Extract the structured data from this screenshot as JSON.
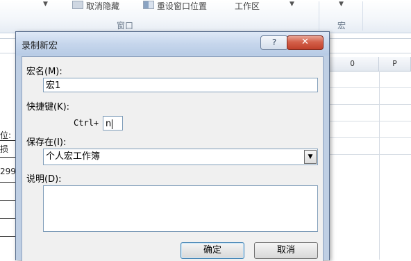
{
  "ribbon": {
    "commands": {
      "hide": "取消隐藏",
      "reset_window": "重设窗口位置",
      "workspace": "工作区"
    },
    "groups": {
      "window": "窗口",
      "macro": "宏"
    }
  },
  "spreadsheet": {
    "columns": [
      "O",
      "P"
    ],
    "cell_fragments": [
      "位:",
      "损",
      "299"
    ]
  },
  "dialog": {
    "title": "录制新宏",
    "help_button": "?",
    "close_button": "✕",
    "macro_name_label": "宏名(M):",
    "macro_name_value": "宏1",
    "shortcut_label": "快捷键(K):",
    "shortcut_prefix": "Ctrl+",
    "shortcut_value": "n",
    "store_in_label": "保存在(I):",
    "store_in_value": "个人宏工作簿",
    "description_label": "说明(D):",
    "description_value": "",
    "ok_button": "确定",
    "cancel_button": "取消"
  }
}
